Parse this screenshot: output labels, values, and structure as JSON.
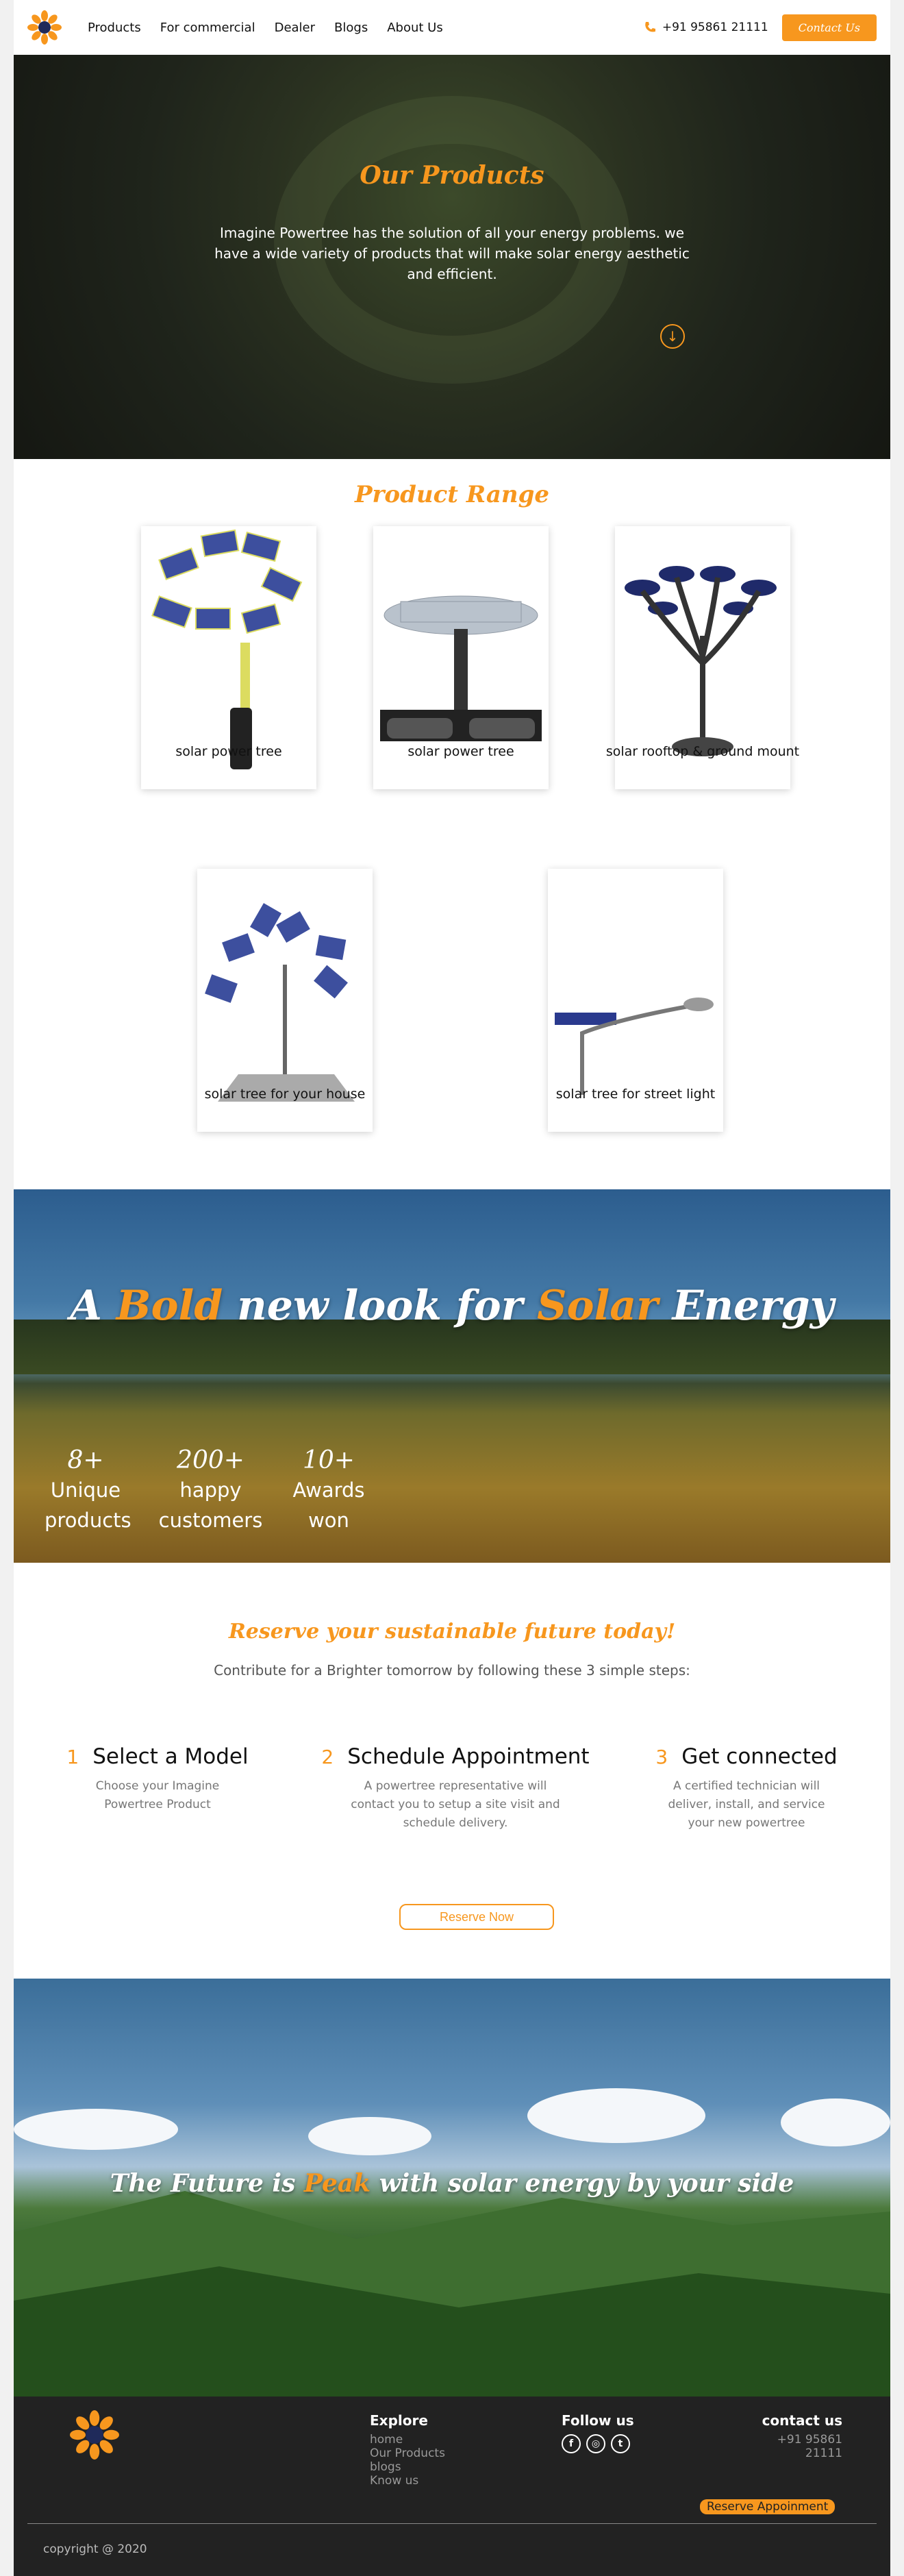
{
  "nav": {
    "links": [
      "Products",
      "For commercial",
      "Dealer",
      "Blogs",
      "About Us"
    ],
    "phone": "+91 95861 21111",
    "contact_label": "Contact Us"
  },
  "hero": {
    "title": "Our Products",
    "description": "Imagine Powertree has the solution of all your energy problems. we have a wide variety of products that will make solar energy aesthetic and efficient."
  },
  "products": {
    "title": "Product Range",
    "items": [
      {
        "label": "solar power tree"
      },
      {
        "label": "solar power tree"
      },
      {
        "label": "solar rooftop & ground mount"
      },
      {
        "label": "solar tree for your house"
      },
      {
        "label": "solar tree for street light"
      }
    ]
  },
  "banner": {
    "title_parts": [
      "A ",
      "Bold",
      " new look for ",
      "Solar",
      " Energy"
    ],
    "stats": [
      {
        "value": "8+",
        "label": "Unique products"
      },
      {
        "value": "200+",
        "label": "happy customers"
      },
      {
        "value": "10+",
        "label": "Awards won"
      }
    ]
  },
  "reserve": {
    "title": "Reserve your sustainable future today!",
    "subtitle": "Contribute for a Brighter tomorrow by following these 3 simple steps:",
    "steps": [
      {
        "num": "1",
        "title": "Select a Model",
        "desc": "Choose your Imagine Powertree Product"
      },
      {
        "num": "2",
        "title": "Schedule Appointment",
        "desc": "A powertree representative will contact you to setup a site visit and schedule delivery."
      },
      {
        "num": "3",
        "title": "Get connected",
        "desc": "A certified technician will deliver, install, and service your new powertree"
      }
    ],
    "button": "Reserve Now"
  },
  "future": {
    "title_parts": [
      "The Future is ",
      "Peak",
      " with solar energy by your side"
    ]
  },
  "footer": {
    "explore_title": "Explore",
    "explore_links": [
      "home",
      "Our Products",
      "blogs",
      "Know us"
    ],
    "follow_title": "Follow us",
    "social_icons": [
      "facebook-icon",
      "instagram-icon",
      "twitter-icon"
    ],
    "contact_title": "contact us",
    "phone": "+91 95861 21111",
    "reserve_button": "Reserve Appoinment",
    "copyright": "copyright @ 2020"
  },
  "colors": {
    "accent": "#f7971e",
    "footer_bg": "#222222"
  }
}
